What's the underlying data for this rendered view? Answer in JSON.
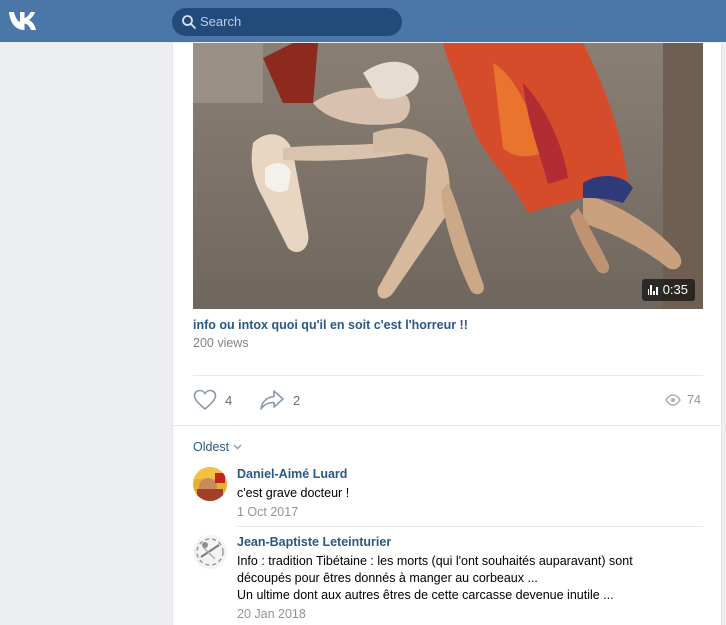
{
  "header": {
    "search_placeholder": "Search"
  },
  "video": {
    "duration": "0:35",
    "title": "info ou intox quoi qu'il en soit c'est l'horreur !!",
    "views": "200 views"
  },
  "actions": {
    "likes": "4",
    "shares": "2",
    "views": "74"
  },
  "comments": {
    "sort_label": "Oldest",
    "items": [
      {
        "author": "Daniel-Aimé Luard",
        "text_lines": [
          "c'est grave docteur !"
        ],
        "date": "1 Oct 2017"
      },
      {
        "author": "Jean-Baptiste Leteinturier",
        "text_lines": [
          "Info : tradition Tibétaine : les morts (qui l'ont souhaités auparavant) sont",
          "découpés pour êtres donnés à manger au corbeaux ...",
          "Un ultime dont aux autres êtres de cette carcasse devenue inutile ..."
        ],
        "date": "20 Jan 2018"
      }
    ]
  },
  "colors": {
    "header_bg": "#4a76a8",
    "link": "#2a5885",
    "muted": "#828282"
  }
}
